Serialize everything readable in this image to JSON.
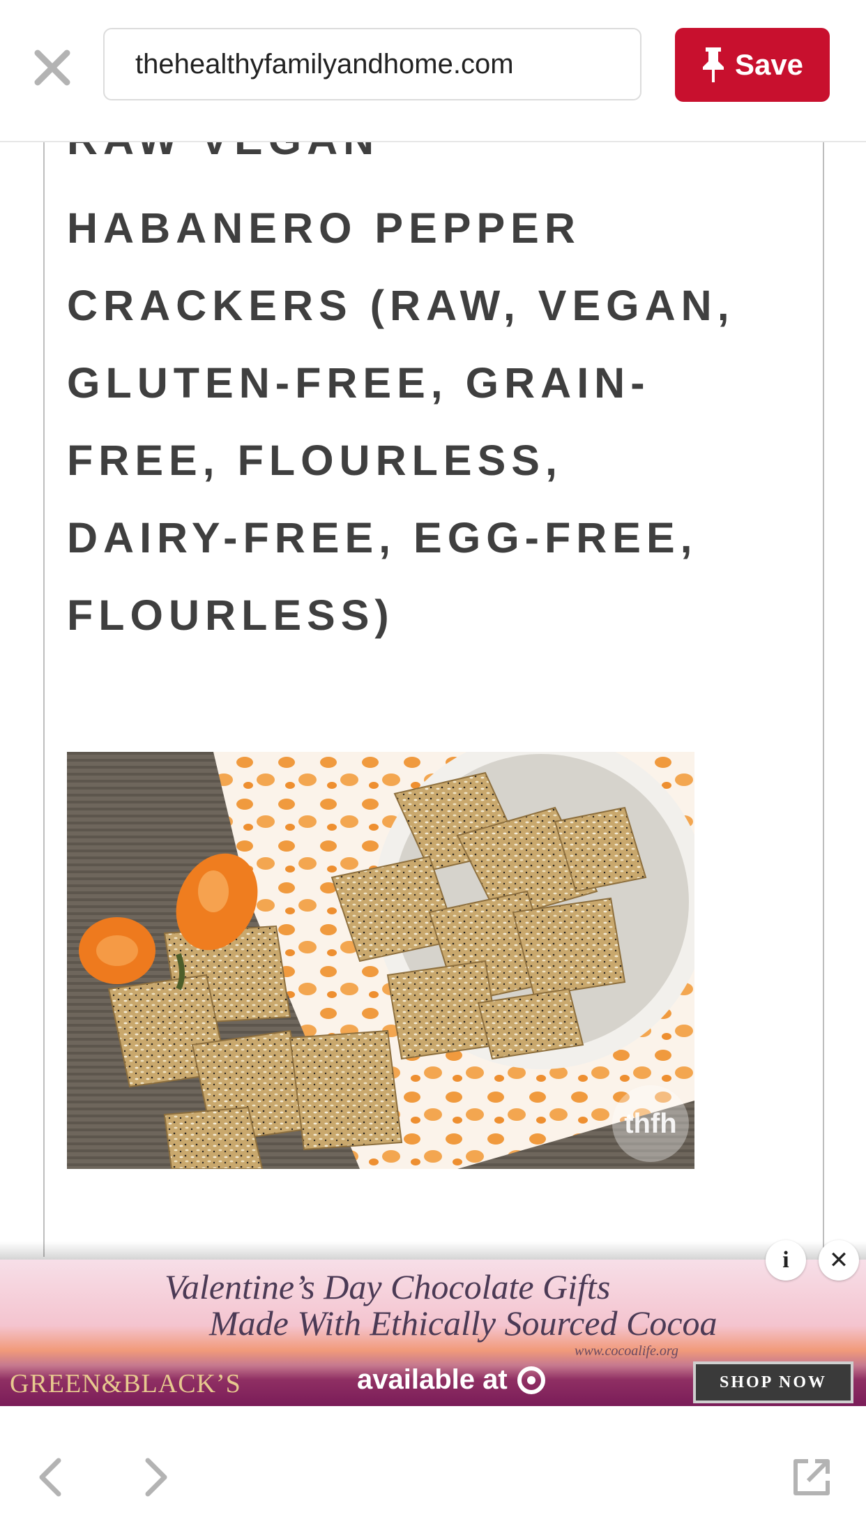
{
  "topbar": {
    "url": "thehealthyfamilyandhome.com",
    "save_label": "Save"
  },
  "article": {
    "headline_cut": "RAW VEGAN",
    "headline": "HABANERO PEPPER CRACKERS (RAW, VEGAN, GLUTEN-FREE, GRAIN-FREE, FLOURLESS, DAIRY-FREE, EGG-FREE, FLOURLESS)",
    "photo_watermark": "thfh"
  },
  "ad": {
    "line1": "Valentine’s Day Chocolate Gifts",
    "line2": "Made With Ethically Sourced Cocoa",
    "url": "www.cocoalife.org",
    "brand": "GREEN&BLACK’S",
    "available": "available at",
    "shop_now": "SHOP NOW",
    "info_glyph": "i",
    "close_glyph": "✕"
  },
  "colors": {
    "save_red": "#c8102e",
    "headline_gray": "#3f3f3f"
  },
  "icons": {
    "close": "close-icon",
    "pin": "pin-icon",
    "back": "chevron-left-icon",
    "forward": "chevron-right-icon",
    "external": "external-link-icon"
  }
}
